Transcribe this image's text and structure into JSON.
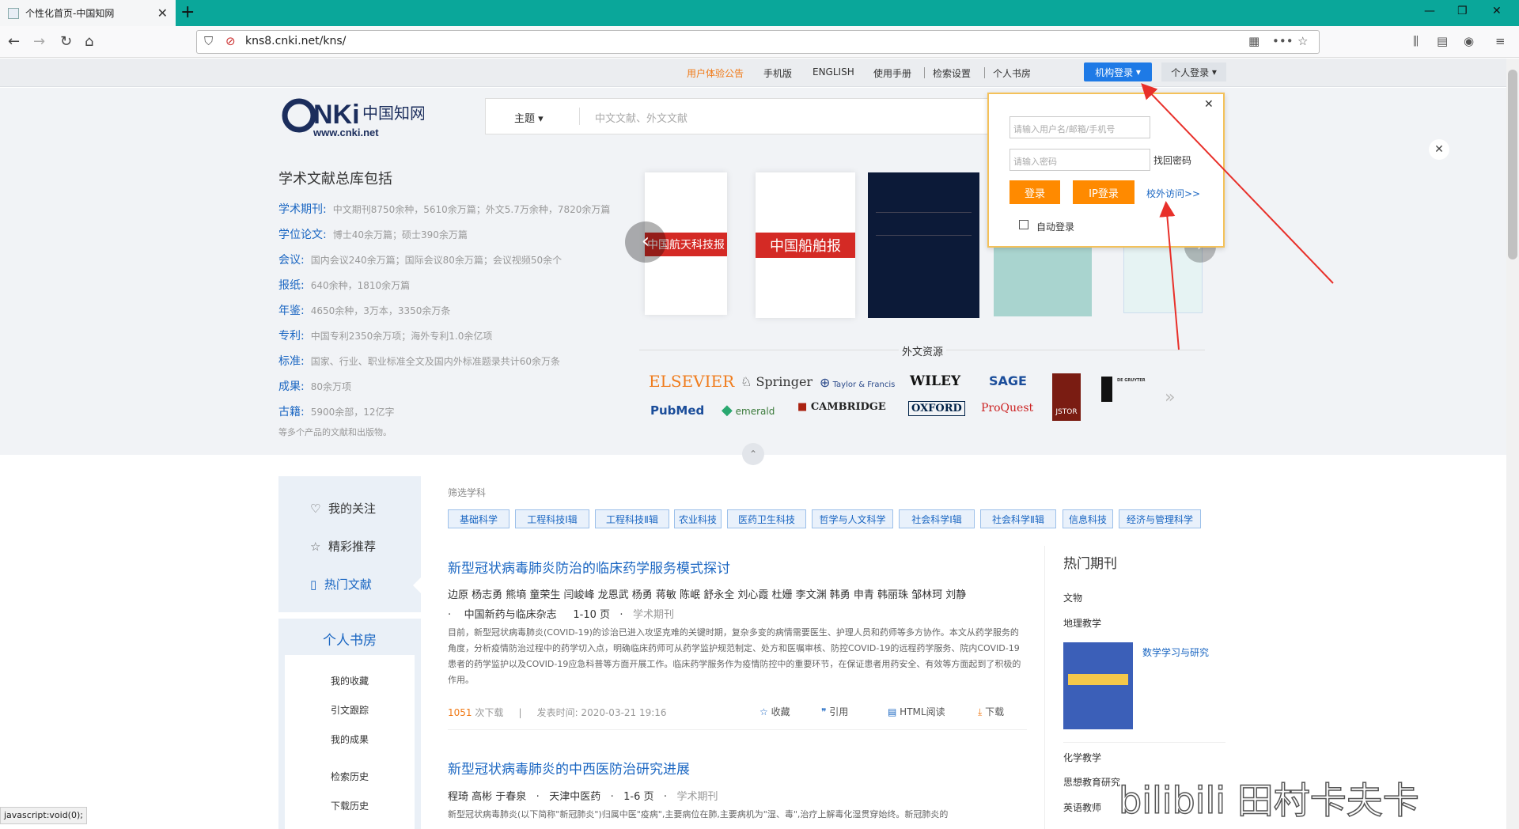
{
  "browser": {
    "tab_title": "个性化首页-中国知网",
    "url": "kns8.cnki.net/kns/",
    "status_text": "javascript:void(0);"
  },
  "topnav": {
    "items": [
      "用户体验公告",
      "手机版",
      "ENGLISH",
      "使用手册",
      "检索设置",
      "个人书房"
    ],
    "inst_login": "机构登录",
    "personal_login": "个人登录"
  },
  "logo": {
    "sub": "www.cnki.net"
  },
  "search": {
    "type": "主题",
    "placeholder": "中文文献、外文文献"
  },
  "library": {
    "title": "学术文献总库包括",
    "rows": [
      {
        "k": "学术期刊:",
        "v": "中文期刊8750余种，5610余万篇；外文5.7万余种，7820余万篇"
      },
      {
        "k": "学位论文:",
        "v": "博士40余万篇；硕士390余万篇"
      },
      {
        "k": "会议:",
        "v": "国内会议240余万篇；国际会议80余万篇；会议视频50余个"
      },
      {
        "k": "报纸:",
        "v": "640余种，1810余万篇"
      },
      {
        "k": "年鉴:",
        "v": "4650余种，3万本，3350余万条"
      },
      {
        "k": "专利:",
        "v": "中国专利2350余万项；海外专利1.0余亿项"
      },
      {
        "k": "标准:",
        "v": "国家、行业、职业标准全文及国内外标准题录共计60余万条"
      },
      {
        "k": "成果:",
        "v": "80余万项"
      },
      {
        "k": "古籍:",
        "v": "5900余部，12亿字"
      }
    ],
    "footer": "等多个产品的文献和出版物。"
  },
  "books": {
    "b1": "中国航天科技报",
    "b2": "中国船舶报"
  },
  "foreign": {
    "title": "外文资源",
    "publishers": [
      "ELSEVIER",
      "Springer",
      "Taylor & Francis",
      "WILEY",
      "SAGE",
      "PubMed",
      "emerald",
      "CAMBRIDGE",
      "OXFORD",
      "ProQuest",
      "JSTOR",
      "DE GRUYTER"
    ]
  },
  "popup": {
    "user_ph": "请输入用户名/邮箱/手机号",
    "pwd_ph": "请输入密码",
    "forgot": "找回密码",
    "login": "登录",
    "ip_login": "IP登录",
    "campus": "校外访问>>",
    "auto": "自动登录"
  },
  "sidebar": {
    "items": [
      "我的关注",
      "精彩推荐",
      "热门文献"
    ],
    "shelf_title": "个人书房",
    "shelf_items": [
      "我的收藏",
      "引文跟踪",
      "我的成果",
      "检索历史",
      "下载历史"
    ]
  },
  "filter": {
    "label": "筛选学科",
    "tags": [
      "基础科学",
      "工程科技Ⅰ辑",
      "工程科技Ⅱ辑",
      "农业科技",
      "医药卫生科技",
      "哲学与人文科学",
      "社会科学Ⅰ辑",
      "社会科学Ⅱ辑",
      "信息科技",
      "经济与管理科学"
    ]
  },
  "articles": [
    {
      "title": "新型冠状病毒肺炎防治的临床药学服务模式探讨",
      "authors": "边原 杨志勇 熊墒 童荣生 闫峻峰 龙恩武 杨勇 蒋敏 陈岷 舒永全 刘心霞 杜姗 李文渊 韩勇 申青 韩丽珠 邹林珂 刘静",
      "source": "中国新药与临床杂志",
      "pages": "1-10 页",
      "type": "学术期刊",
      "abstract": "目前，新型冠状病毒肺炎(COVID-19)的诊治已进入攻坚克难的关键时期，复杂多变的病情需要医生、护理人员和药师等多方协作。本文从药学服务的角度，分析疫情防治过程中的药学切入点，明确临床药师可从药学监护规范制定、处方和医嘱审核、防控COVID-19的远程药学服务、院内COVID-19患者的药学监护以及COVID-19应急科普等方面开展工作。临床药学服务作为疫情防控中的重要环节，在保证患者用药安全、有效等方面起到了积极的作用。",
      "downloads": "1051",
      "downloads_unit": "次下载",
      "date": "发表时间: 2020-03-21 19:16",
      "actions": [
        "收藏",
        "引用",
        "HTML阅读",
        "下载"
      ]
    },
    {
      "title": "新型冠状病毒肺炎的中西医防治研究进展",
      "authors": "程琦 高彬 于春泉",
      "source": "天津中医药",
      "pages": "1-6 页",
      "type": "学术期刊",
      "abstract": "新型冠状病毒肺炎(以下简称\"新冠肺炎\")归属中医\"疫病\",主要病位在肺,主要病机为\"湿、毒\",治疗上解毒化湿贯穿始终。新冠肺炎的"
    }
  ],
  "hot": {
    "title": "热门期刊",
    "links": [
      "文物",
      "地理教学"
    ],
    "featured": "数学学习与研究",
    "links2": [
      "化学教学",
      "思想教育研究",
      "英语教师"
    ]
  },
  "watermark": "bilibili 田村卡夫卡"
}
